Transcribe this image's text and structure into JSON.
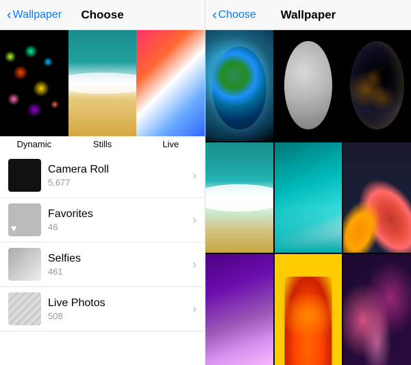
{
  "left_panel": {
    "nav": {
      "back_label": "Wallpaper",
      "title": "Choose"
    },
    "categories": [
      {
        "id": "dynamic",
        "label": "Dynamic"
      },
      {
        "id": "stills",
        "label": "Stills"
      },
      {
        "id": "live",
        "label": "Live"
      }
    ],
    "albums": [
      {
        "id": "camera-roll",
        "name": "Camera Roll",
        "count": "5,677"
      },
      {
        "id": "favorites",
        "name": "Favorites",
        "count": "46"
      },
      {
        "id": "selfies",
        "name": "Selfies",
        "count": "461"
      },
      {
        "id": "live-photos",
        "name": "Live Photos",
        "count": "508"
      }
    ]
  },
  "right_panel": {
    "nav": {
      "back_label": "Choose",
      "title": "Wallpaper"
    },
    "grid": {
      "cells": [
        "earth",
        "moon",
        "earth-night",
        "ocean",
        "wave-teal",
        "floral",
        "purple-gradient",
        "orange-flower",
        "pink-flowers"
      ]
    }
  }
}
